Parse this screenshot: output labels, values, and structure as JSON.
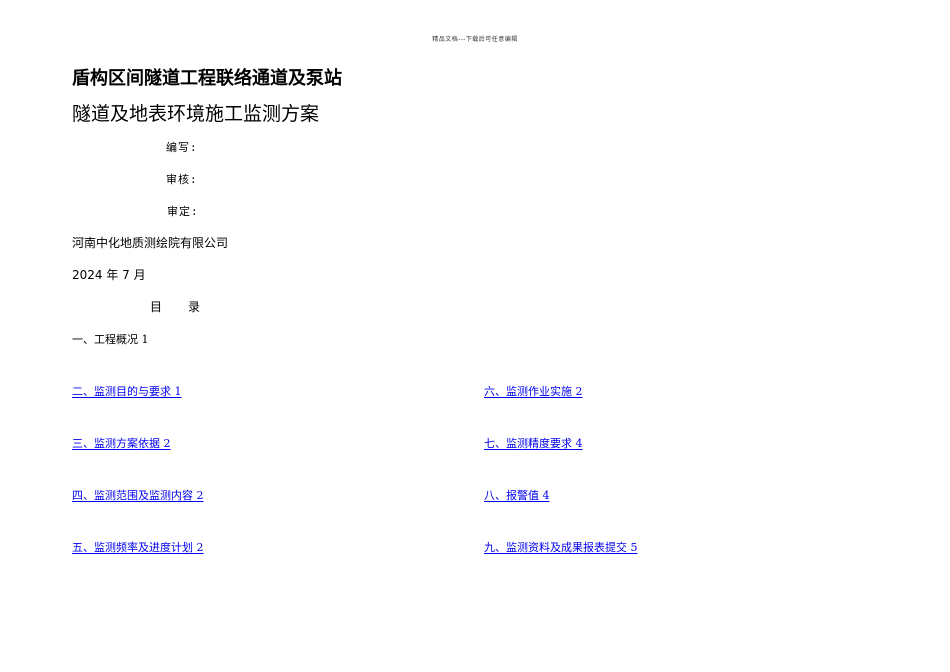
{
  "header_note": "精品文档---下载后可任意编辑",
  "title": {
    "line1": "盾构区间隧道工程联络通道及泵站",
    "line2": "隧道及地表环境施工监测方案"
  },
  "signatures": {
    "compile": "编写:",
    "review": "审核:",
    "approve": "审定:"
  },
  "organization": "河南中化地质测绘院有限公司",
  "date": "2024 年 7 月",
  "toc": {
    "heading_char1": "目",
    "heading_char2": "录",
    "first_item": "一、工程概况 1",
    "left_items": [
      "二、监测目的与要求 1",
      "三、监测方案依据 2",
      "四、监测范围及监测内容 2",
      "五、监测频率及进度计划 2"
    ],
    "right_items": [
      "六、监测作业实施 2",
      "七、监测精度要求 4",
      "八、报警值 4",
      "九、监测资料及成果报表提交 5"
    ]
  },
  "colors": {
    "link": "#0000ee",
    "text": "#000000"
  }
}
